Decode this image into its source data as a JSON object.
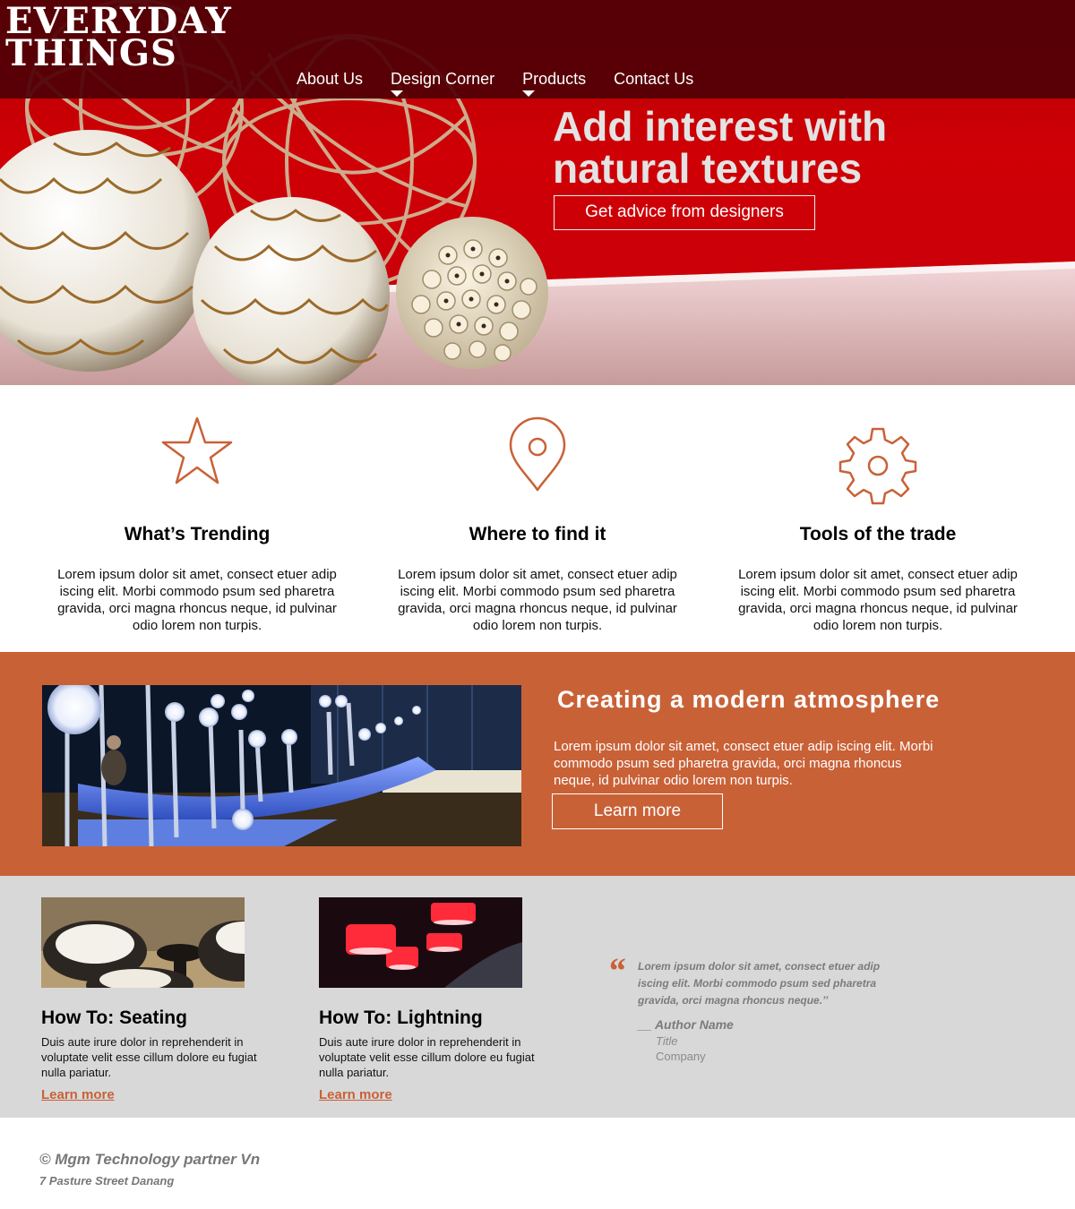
{
  "brand": {
    "line1": "EVERYDAY",
    "line2": "THINGS"
  },
  "nav": {
    "items": [
      {
        "label": "About Us",
        "has_dropdown": false
      },
      {
        "label": "Design Corner",
        "has_dropdown": true
      },
      {
        "label": "Products",
        "has_dropdown": true
      },
      {
        "label": "Contact Us",
        "has_dropdown": false
      }
    ]
  },
  "hero": {
    "headline_line1": "Add interest with",
    "headline_line2": "natural textures",
    "cta_label": "Get advice from designers"
  },
  "features": [
    {
      "icon": "star-icon",
      "title": "What’s Trending",
      "text": "Lorem ipsum dolor sit amet, consect etuer adip iscing elit. Morbi commodo psum sed pharetra gravida, orci magna rhoncus neque, id pulvinar odio lorem non turpis."
    },
    {
      "icon": "map-pin-icon",
      "title": "Where to find it",
      "text": "Lorem ipsum dolor sit amet, consect etuer adip iscing elit. Morbi commodo psum sed pharetra gravida, orci magna rhoncus neque, id pulvinar odio lorem non turpis."
    },
    {
      "icon": "gear-icon",
      "title": "Tools of the trade",
      "text": "Lorem ipsum dolor sit amet, consect etuer adip iscing elit. Morbi commodo psum sed pharetra gravida, orci magna rhoncus neque, id pulvinar odio lorem non turpis."
    }
  ],
  "atmosphere": {
    "title": "Creating a modern atmosphere",
    "text": "Lorem ipsum dolor sit amet, consect etuer adip iscing elit. Morbi commodo psum sed pharetra gravida, orci magna rhoncus neque, id pulvinar odio lorem non turpis.",
    "cta_label": "Learn more"
  },
  "howto": [
    {
      "title": "How To: Seating",
      "text": "Duis aute irure dolor in reprehenderit in voluptate velit esse cillum dolore eu fugiat nulla pariatur.",
      "link": "Learn more"
    },
    {
      "title": "How To: Lightning",
      "text": "Duis aute irure dolor in reprehenderit in voluptate velit esse cillum dolore eu fugiat nulla pariatur.",
      "link": "Learn more"
    }
  ],
  "testimonial": {
    "quote": "Lorem ipsum dolor sit amet, consect etuer adip iscing elit. Morbi commodo psum sed pharetra gravida, orci magna rhoncus neque.’’",
    "author": "__ Author Name",
    "title": "Title",
    "company": "Company"
  },
  "footer": {
    "copyright": "© Mgm Technology partner Vn",
    "address": "7 Pasture Street Danang"
  },
  "colors": {
    "accent": "#c96137",
    "hero_red": "#cf0006",
    "topbar": "#500005",
    "grey_band": "#d8d8d8"
  }
}
